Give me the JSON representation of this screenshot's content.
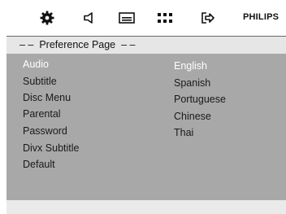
{
  "toolbar": {
    "icons": [
      "gear-icon",
      "speaker-icon",
      "subtitle-icon",
      "dots-grid-icon",
      "exit-icon"
    ],
    "brand": "PHILIPS"
  },
  "header": {
    "title": "– –  Preference Page  – –"
  },
  "menu": {
    "items": [
      "Audio",
      "Subtitle",
      "Disc Menu",
      "Parental",
      "Password",
      "Divx Subtitle",
      "Default"
    ],
    "selected_item": "Audio"
  },
  "options": {
    "items": [
      "English",
      "Spanish",
      "Portuguese",
      "Chinese",
      "Thai"
    ],
    "selected_option": "English"
  },
  "colors": {
    "panel": "#a8a8a8",
    "header": "#e6e6e6",
    "selected_text": "#ffffff"
  }
}
